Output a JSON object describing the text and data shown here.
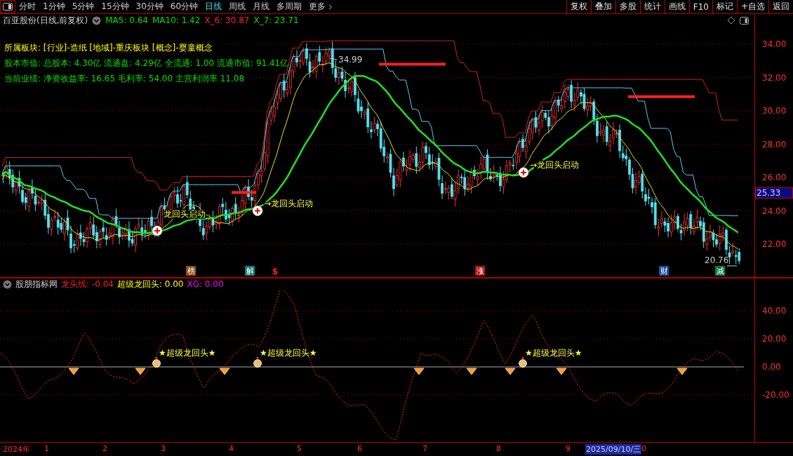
{
  "toolbar": {
    "periods": [
      {
        "label": "分时",
        "selected": false
      },
      {
        "label": "1分钟",
        "selected": false
      },
      {
        "label": "5分钟",
        "selected": false
      },
      {
        "label": "15分钟",
        "selected": false
      },
      {
        "label": "30分钟",
        "selected": false
      },
      {
        "label": "60分钟",
        "selected": false
      },
      {
        "label": "日线",
        "selected": true
      },
      {
        "label": "周线",
        "selected": false
      },
      {
        "label": "月线",
        "selected": false
      },
      {
        "label": "多周期",
        "selected": false
      },
      {
        "label": "更多",
        "selected": false
      }
    ],
    "actions": [
      "复权",
      "叠加",
      "多股",
      "统计",
      "画线",
      "F10",
      "标记",
      "+自选",
      "返回"
    ]
  },
  "main_chart": {
    "title": "百亚股份(日线,前复权)",
    "legend": [
      {
        "label": "MA5: 0.64",
        "color": "#00e000"
      },
      {
        "label": "MA10: 1.42",
        "color": "#00e000"
      },
      {
        "label": "X_6: 30.87",
        "color": "#ff2020"
      },
      {
        "label": "X_7: 23.71",
        "color": "#00e000"
      }
    ],
    "info_lines": [
      {
        "text": "所属板块: [行业]-造纸 [地域]-重庆板块 [概念]-婴童概念",
        "color": "#ffff00"
      },
      {
        "text": "股本市值: 总股本: 4.30亿 流通盘: 4.29亿 全流通: 1.00 流通市值: 91.41亿",
        "color": "#00e000"
      },
      {
        "text": "当前业绩: 净资收益率: 16.65 毛利率: 54.00 主营利润率 11.08",
        "color": "#00e000"
      }
    ],
    "y_ticks": [
      "34.00",
      "32.00",
      "30.00",
      "28.00",
      "26.00",
      "24.00",
      "22.00"
    ],
    "current_price": "25.33",
    "high_label": "34.99",
    "low_label": "20.76",
    "signals": [
      "龙回头启动",
      "→龙回头启动",
      "→龙回头启动"
    ],
    "events": [
      {
        "label": "榜",
        "kind": "tag",
        "color": "#8b4a1a"
      },
      {
        "label": "解",
        "kind": "tag",
        "color": "#107878"
      },
      {
        "label": "$",
        "kind": "mark",
        "color": "#ff2020"
      },
      {
        "label": "涨",
        "kind": "tag",
        "color": "#b01010"
      },
      {
        "label": "财",
        "kind": "tag",
        "color": "#1c4f9c"
      },
      {
        "label": "减",
        "kind": "tag",
        "color": "#0e7a3a"
      }
    ]
  },
  "indicator": {
    "title": "股朋指标网",
    "values": [
      {
        "label": "龙头线: -0.04",
        "color": "#ff2020"
      },
      {
        "label": "超级龙回头: 0.00",
        "color": "#ffff00"
      },
      {
        "label": "XG: 0.00",
        "color": "#ff00ff"
      }
    ],
    "y_ticks": [
      "40.00",
      "20.00",
      "0.00",
      "-20.00"
    ],
    "signals": [
      "★超级龙回头★",
      "★超级龙回头★",
      "★超级龙回头★"
    ]
  },
  "time_axis": [
    {
      "label": "2024年",
      "selected": false
    },
    {
      "label": "1",
      "selected": false
    },
    {
      "label": "2",
      "selected": false
    },
    {
      "label": "3",
      "selected": false
    },
    {
      "label": "4",
      "selected": false
    },
    {
      "label": "5",
      "selected": false
    },
    {
      "label": "6",
      "selected": false
    },
    {
      "label": "7",
      "selected": false
    },
    {
      "label": "8",
      "selected": false
    },
    {
      "label": "9",
      "selected": false
    },
    {
      "label": "2025/09/10/三",
      "selected": true
    },
    {
      "label": "0",
      "selected": false
    }
  ]
}
